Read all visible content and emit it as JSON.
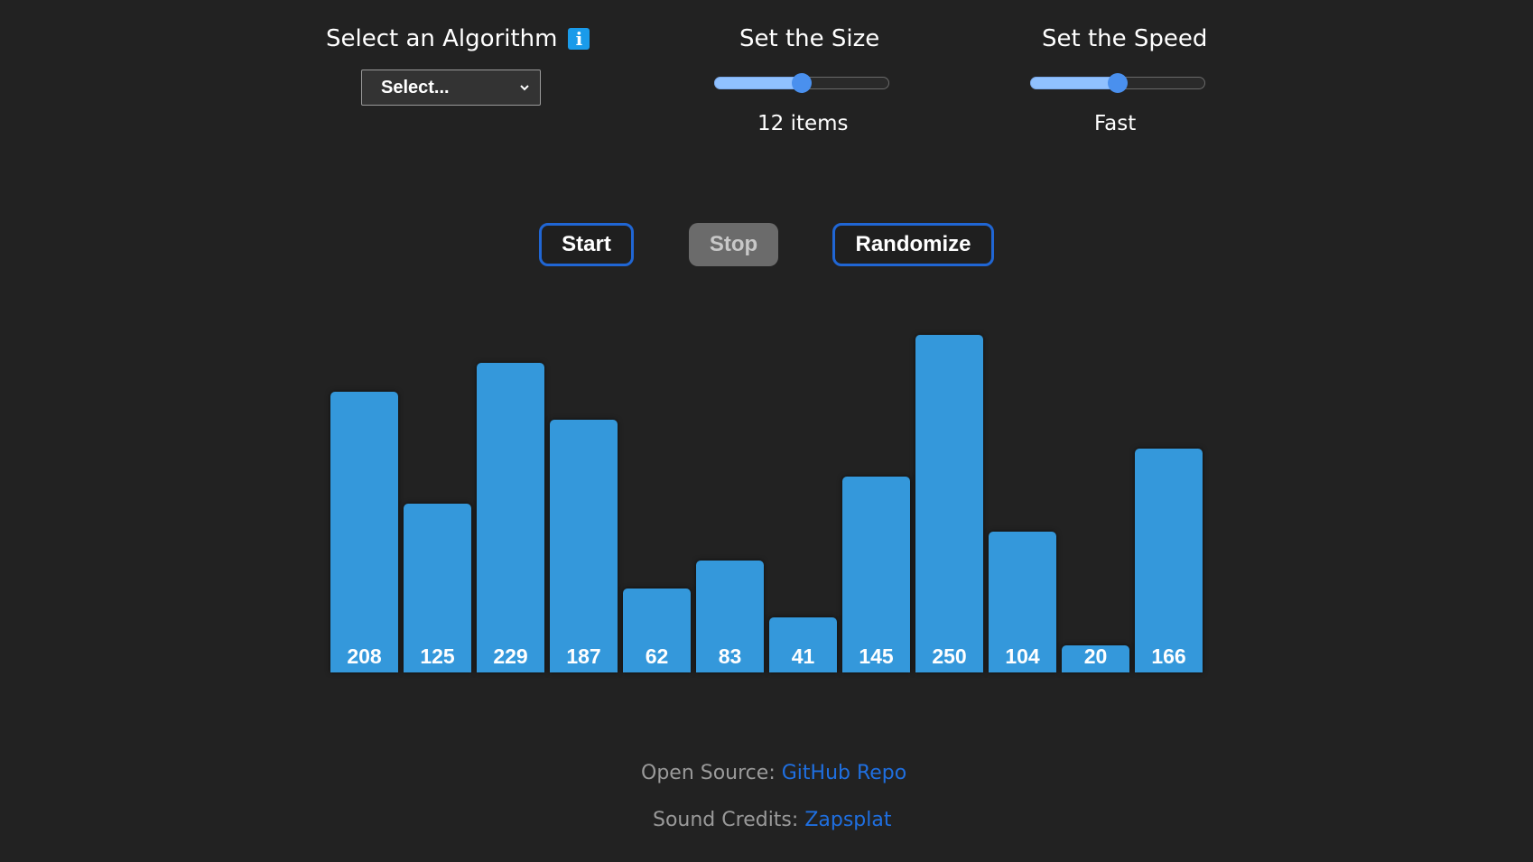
{
  "algorithm": {
    "heading": "Select an Algorithm",
    "info_icon": "i",
    "select_value": "Select..."
  },
  "size": {
    "heading": "Set the Size",
    "label": "12 items",
    "slider_percent": 50
  },
  "speed": {
    "heading": "Set the Speed",
    "label": "Fast",
    "slider_percent": 50
  },
  "buttons": {
    "start": "Start",
    "stop": "Stop",
    "randomize": "Randomize"
  },
  "colors": {
    "bar": "#3498db",
    "accent": "#2066d4",
    "link": "#1f6fe0",
    "background": "#222222"
  },
  "chart_data": {
    "type": "bar",
    "values": [
      208,
      125,
      229,
      187,
      62,
      83,
      41,
      145,
      250,
      104,
      20,
      166
    ],
    "ylim": [
      0,
      250
    ]
  },
  "footer": {
    "open_source_label": "Open Source:",
    "open_source_link": "GitHub Repo",
    "sound_label": "Sound Credits:",
    "sound_link": "Zapsplat"
  }
}
